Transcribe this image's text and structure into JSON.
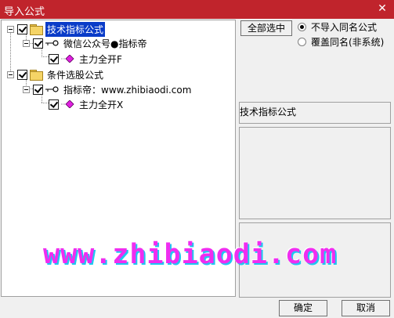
{
  "window": {
    "title": "导入公式",
    "close_symbol": "✕"
  },
  "tree": [
    {
      "label": "技术指标公式",
      "kind": "folder",
      "selected": true
    },
    {
      "label": "微信公众号●指标帝",
      "kind": "group"
    },
    {
      "label": "主力全开F",
      "kind": "formula"
    },
    {
      "label": "条件选股公式",
      "kind": "folder",
      "selected": false
    },
    {
      "label": "指标帝：www.zhibiaodi.com",
      "kind": "group"
    },
    {
      "label": "主力全开X",
      "kind": "formula"
    }
  ],
  "options": {
    "select_all_label": "全部选中",
    "radio_skip_label": "不导入同名公式",
    "radio_overwrite_label": "覆盖同名(非系统)",
    "selected_radio": "skip"
  },
  "info": {
    "category_label": "技术指标公式"
  },
  "buttons": {
    "ok": "确定",
    "cancel": "取消"
  },
  "watermark": "www.zhibiaodi.com",
  "colors": {
    "titlebar": "#c0242c",
    "selection": "#0a3cc8",
    "watermark_fill": "#f02df0",
    "watermark_shadow": "#1ec8f0"
  }
}
